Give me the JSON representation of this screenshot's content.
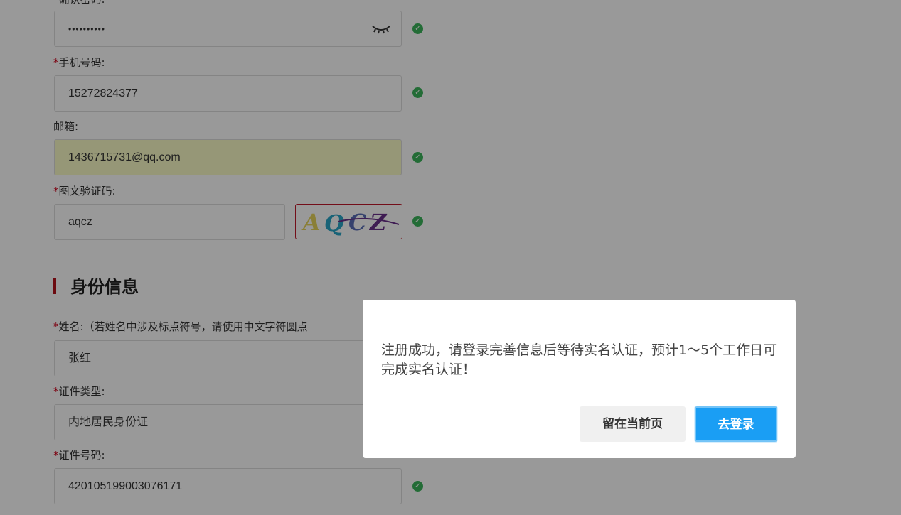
{
  "form": {
    "confirm_password": {
      "label": "确认密码:",
      "value": "••••••••••"
    },
    "phone": {
      "label": "手机号码:",
      "value": "15272824377"
    },
    "email": {
      "label": "邮箱:",
      "value": "1436715731@qq.com"
    },
    "captcha": {
      "label": "图文验证码:",
      "value": "aqcz",
      "image_text": "AQCZ"
    },
    "identity_section_title": "身份信息",
    "name": {
      "label": "姓名:（若姓名中涉及标点符号，请使用中文字符圆点",
      "value": "张红"
    },
    "id_type": {
      "label": "证件类型:",
      "value": "内地居民身份证"
    },
    "id_number": {
      "label": "证件号码:",
      "value": "420105199003076171"
    },
    "required_mark": "*",
    "valid_icon": "check-circle-icon",
    "show_password_icon": "eye-closed-icon"
  },
  "dialog": {
    "message": "注册成功，请登录完善信息后等待实名认证，预计1～5个工作日可完成实名认证！",
    "stay_button": "留在当前页",
    "login_button": "去登录"
  },
  "colors": {
    "accent_red": "#b5121b",
    "success_green": "#3bb55b",
    "primary_blue": "#1a9ef4",
    "autofill_yellow": "#fafcc7"
  }
}
